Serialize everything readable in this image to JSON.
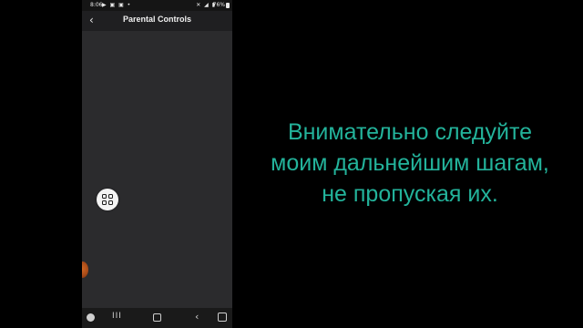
{
  "phone": {
    "status_bar": {
      "time": "8:06",
      "left_icons": "▶ ▣ ▣ •",
      "right_icons": "✕ ◢ ▮",
      "battery": "76%"
    },
    "app_bar": {
      "back_icon": "chevron-left-icon",
      "title": "Parental Controls"
    },
    "floating_button_icon": "apps-grid-icon",
    "nav_bar": {
      "recents": "III",
      "back": "‹"
    }
  },
  "caption": {
    "lines": [
      "Внимательно следуйте",
      "моим дальнейшим шагам,",
      "не пропуская их."
    ],
    "color": "#23b39b"
  }
}
